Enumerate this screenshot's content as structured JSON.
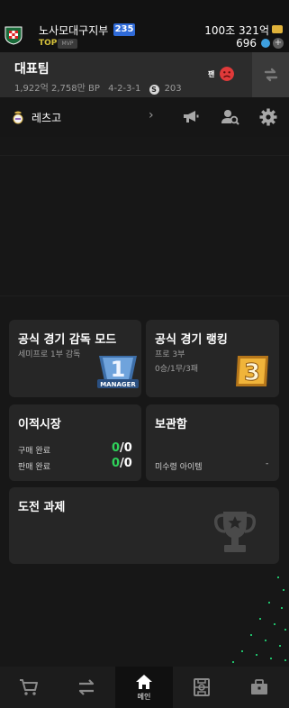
{
  "topbar": {
    "club_name": "노사모대구지부",
    "level": "235",
    "rank_label": "TOP",
    "mvp_label": "MVP",
    "money": "100조 321억",
    "points": "696"
  },
  "team": {
    "name": "대표팀",
    "value": "1,922억 2,758만 BP",
    "formation": "4-2-3-1",
    "s_value": "203",
    "fan_label": "팬"
  },
  "manager": {
    "name": "레츠고"
  },
  "cards": {
    "manager_mode": {
      "title": "공식 경기 감독 모드",
      "subtitle": "세미프로 1부 감독",
      "badge_text": "MANAGER",
      "badge_number": "1"
    },
    "ranking": {
      "title": "공식 경기 랭킹",
      "subtitle1": "프로 3부",
      "subtitle2": "0승/1무/3패",
      "badge_number": "3"
    },
    "transfer": {
      "title": "이적시장",
      "buy_label": "구매 완료",
      "buy_done": "0",
      "buy_total": "0",
      "sell_label": "판매 완료",
      "sell_done": "0",
      "sell_total": "0"
    },
    "storage": {
      "title": "보관함",
      "unclaimed_label": "미수령 아이템",
      "unclaimed_value": "-"
    },
    "challenge": {
      "title": "도전 과제"
    }
  },
  "nav": {
    "home_label": "메인"
  },
  "colors": {
    "accent_green": "#2fd25a",
    "card_bg": "#262626",
    "badge_blue": "#2f6ad7"
  }
}
